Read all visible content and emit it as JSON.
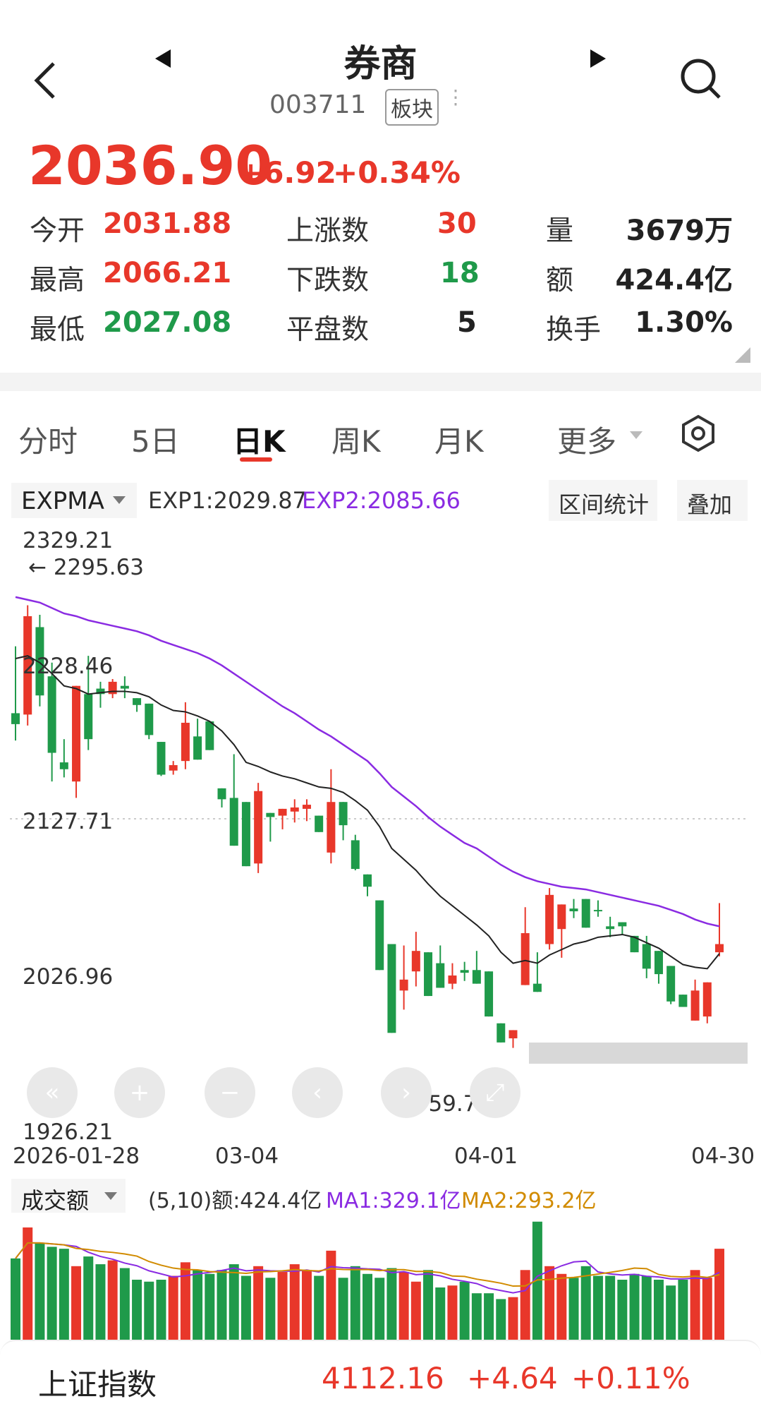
{
  "nav": {
    "title": "券商",
    "code": "003711",
    "badge": "板块"
  },
  "quote": {
    "price": "2036.90",
    "change": "+6.92",
    "change_pct": "+0.34%"
  },
  "stats": {
    "open_label": "今开",
    "open": "2031.88",
    "high_label": "最高",
    "high": "2066.21",
    "low_label": "最低",
    "low": "2027.08",
    "up_label": "上涨数",
    "up": "30",
    "down_label": "下跌数",
    "down": "18",
    "flat_label": "平盘数",
    "flat": "5",
    "vol_label": "量",
    "vol": "3679万",
    "amt_label": "额",
    "amt": "424.4亿",
    "turnover_label": "换手",
    "turnover": "1.30%"
  },
  "tabs": [
    "分时",
    "5日",
    "日K",
    "周K",
    "月K",
    "更多"
  ],
  "active_tab": "日K",
  "indicator": {
    "name": "EXPMA",
    "exp1": "EXP1:2029.87",
    "exp2": "EXP2:2085.66",
    "range_stats": "区间统计",
    "overlay": "叠加"
  },
  "price_axis": {
    "top": "2329.21",
    "high_marker": "← 2295.63",
    "l2": "2228.46",
    "l3": "2127.71",
    "l4": "2026.96",
    "bottom": "1926.21",
    "low_marker": "1959.79 →"
  },
  "date_axis": [
    "2026-01-28",
    "03-04",
    "04-01",
    "04-30"
  ],
  "volume_header": {
    "name": "成交额",
    "params": "(5,10)额:424.4亿",
    "ma1": "MA1:329.1亿",
    "ma2": "MA2:293.2亿"
  },
  "footer": {
    "index_name": "上证指数",
    "index_value": "4112.16",
    "index_change": "+4.64",
    "index_pct": "+0.11%"
  },
  "colors": {
    "up": "#e8372a",
    "down": "#1f9a4a",
    "exp2": "#8a2be2",
    "ma2": "#d18b00"
  },
  "chart_data": {
    "type": "candlestick",
    "candles": [
      {
        "o": 2205,
        "h": 2254,
        "l": 2185,
        "c": 2197
      },
      {
        "o": 2204,
        "h": 2284,
        "l": 2196,
        "c": 2276
      },
      {
        "o": 2268,
        "h": 2277,
        "l": 2210,
        "c": 2218
      },
      {
        "o": 2232,
        "h": 2242,
        "l": 2155,
        "c": 2176
      },
      {
        "o": 2169,
        "h": 2186,
        "l": 2158,
        "c": 2164
      },
      {
        "o": 2155,
        "h": 2224,
        "l": 2143,
        "c": 2225
      },
      {
        "o": 2219,
        "h": 2247,
        "l": 2178,
        "c": 2186
      },
      {
        "o": 2223,
        "h": 2228,
        "l": 2209,
        "c": 2219
      },
      {
        "o": 2219,
        "h": 2230,
        "l": 2216,
        "c": 2228
      },
      {
        "o": 2225,
        "h": 2232,
        "l": 2216,
        "c": 2223
      },
      {
        "o": 2216,
        "h": 2213,
        "l": 2206,
        "c": 2211
      },
      {
        "o": 2212,
        "h": 2212,
        "l": 2186,
        "c": 2189
      },
      {
        "o": 2184,
        "h": 2180,
        "l": 2159,
        "c": 2160
      },
      {
        "o": 2163,
        "h": 2170,
        "l": 2160,
        "c": 2167
      },
      {
        "o": 2170,
        "h": 2213,
        "l": 2164,
        "c": 2198
      },
      {
        "o": 2188,
        "h": 2201,
        "l": 2171,
        "c": 2171
      },
      {
        "o": 2199,
        "h": 2196,
        "l": 2181,
        "c": 2178
      },
      {
        "o": 2150,
        "h": 2150,
        "l": 2136,
        "c": 2142
      },
      {
        "o": 2143,
        "h": 2175,
        "l": 2108,
        "c": 2108
      },
      {
        "o": 2140,
        "h": 2140,
        "l": 2135,
        "c": 2093
      },
      {
        "o": 2095,
        "h": 2154,
        "l": 2088,
        "c": 2148
      },
      {
        "o": 2132,
        "h": 2129,
        "l": 2111,
        "c": 2129
      },
      {
        "o": 2130,
        "h": 2135,
        "l": 2120,
        "c": 2135
      },
      {
        "o": 2133,
        "h": 2142,
        "l": 2125,
        "c": 2136
      },
      {
        "o": 2135,
        "h": 2142,
        "l": 2126,
        "c": 2138
      },
      {
        "o": 2130,
        "h": 2127,
        "l": 2118,
        "c": 2118
      },
      {
        "o": 2103,
        "h": 2164,
        "l": 2095,
        "c": 2140
      },
      {
        "o": 2140,
        "h": 2126,
        "l": 2112,
        "c": 2123
      },
      {
        "o": 2112,
        "h": 2116,
        "l": 2090,
        "c": 2091
      },
      {
        "o": 2087,
        "h": 2087,
        "l": 2071,
        "c": 2078
      },
      {
        "o": 2068,
        "h": 2068,
        "l": 2061,
        "c": 2017
      },
      {
        "o": 2036,
        "h": 2036,
        "l": 2005,
        "c": 1971
      },
      {
        "o": 2002,
        "h": 2035,
        "l": 1988,
        "c": 2010
      },
      {
        "o": 2016,
        "h": 2045,
        "l": 2005,
        "c": 2031
      },
      {
        "o": 2030,
        "h": 2030,
        "l": 1999,
        "c": 1998
      },
      {
        "o": 2022,
        "h": 2035,
        "l": 2004,
        "c": 2004
      },
      {
        "o": 2007,
        "h": 2022,
        "l": 2003,
        "c": 2013
      },
      {
        "o": 2017,
        "h": 2023,
        "l": 2009,
        "c": 2015
      },
      {
        "o": 2017,
        "h": 2031,
        "l": 2014,
        "c": 2007
      },
      {
        "o": 2016,
        "h": 2016,
        "l": 1983,
        "c": 1983
      },
      {
        "o": 1978,
        "h": 1978,
        "l": 1964,
        "c": 1964
      },
      {
        "o": 1967,
        "h": 1967,
        "l": 1960,
        "c": 1973
      },
      {
        "o": 2006,
        "h": 2063,
        "l": 2006,
        "c": 2044
      },
      {
        "o": 2007,
        "h": 2030,
        "l": 2001,
        "c": 2001
      },
      {
        "o": 2036,
        "h": 2077,
        "l": 2032,
        "c": 2072
      },
      {
        "o": 2047,
        "h": 2065,
        "l": 2026,
        "c": 2065
      },
      {
        "o": 2062,
        "h": 2069,
        "l": 2055,
        "c": 2060
      },
      {
        "o": 2069,
        "h": 2068,
        "l": 2048,
        "c": 2048
      },
      {
        "o": 2061,
        "h": 2068,
        "l": 2056,
        "c": 2060
      },
      {
        "o": 2049,
        "h": 2056,
        "l": 2041,
        "c": 2047
      },
      {
        "o": 2052,
        "h": 2052,
        "l": 2043,
        "c": 2049
      },
      {
        "o": 2042,
        "h": 2042,
        "l": 2030,
        "c": 2030
      },
      {
        "o": 2036,
        "h": 2042,
        "l": 2011,
        "c": 2018
      },
      {
        "o": 2031,
        "h": 2031,
        "l": 2007,
        "c": 2014
      },
      {
        "o": 2020,
        "h": 2019,
        "l": 1992,
        "c": 1994
      },
      {
        "o": 1999,
        "h": 1999,
        "l": 1990,
        "c": 1990
      },
      {
        "o": 1980,
        "h": 2010,
        "l": 1980,
        "c": 2002
      },
      {
        "o": 1983,
        "h": 2008,
        "l": 1978,
        "c": 2008
      },
      {
        "o": 2030,
        "h": 2066,
        "l": 2027,
        "c": 2036
      }
    ],
    "volume": [
      42,
      58,
      50,
      48,
      47,
      38,
      43,
      39,
      41,
      37,
      31,
      30,
      31,
      33,
      40,
      36,
      34,
      36,
      39,
      33,
      38,
      32,
      35,
      39,
      36,
      33,
      46,
      32,
      38,
      34,
      32,
      37,
      35,
      30,
      36,
      27,
      28,
      30,
      24,
      24,
      21,
      22,
      36,
      61,
      38,
      34,
      32,
      38,
      33,
      33,
      31,
      34,
      33,
      31,
      28,
      31,
      36,
      32,
      47
    ],
    "exp1": [
      2245,
      2247,
      2242,
      2234,
      2225,
      2223,
      2219,
      2220,
      2221,
      2221,
      2220,
      2217,
      2211,
      2207,
      2206,
      2203,
      2199,
      2192,
      2182,
      2169,
      2166,
      2162,
      2159,
      2157,
      2154,
      2151,
      2150,
      2147,
      2141,
      2134,
      2122,
      2106,
      2098,
      2090,
      2080,
      2071,
      2064,
      2057,
      2050,
      2042,
      2030,
      2022,
      2024,
      2022,
      2028,
      2032,
      2036,
      2038,
      2041,
      2042,
      2043,
      2041,
      2037,
      2033,
      2027,
      2021,
      2019,
      2018,
      2029
    ],
    "exp2": [
      2290,
      2288,
      2286,
      2282,
      2278,
      2276,
      2273,
      2271,
      2269,
      2267,
      2265,
      2262,
      2258,
      2255,
      2252,
      2249,
      2245,
      2240,
      2234,
      2228,
      2222,
      2216,
      2210,
      2205,
      2199,
      2193,
      2188,
      2182,
      2176,
      2170,
      2161,
      2151,
      2144,
      2137,
      2129,
      2122,
      2116,
      2110,
      2106,
      2100,
      2094,
      2089,
      2085,
      2082,
      2080,
      2078,
      2077,
      2076,
      2074,
      2072,
      2070,
      2068,
      2066,
      2064,
      2061,
      2058,
      2054,
      2051,
      2049
    ],
    "ylim": [
      1926.21,
      2329.21
    ],
    "xlabels": [
      "2026-01-28",
      "03-04",
      "04-01",
      "04-30"
    ]
  }
}
